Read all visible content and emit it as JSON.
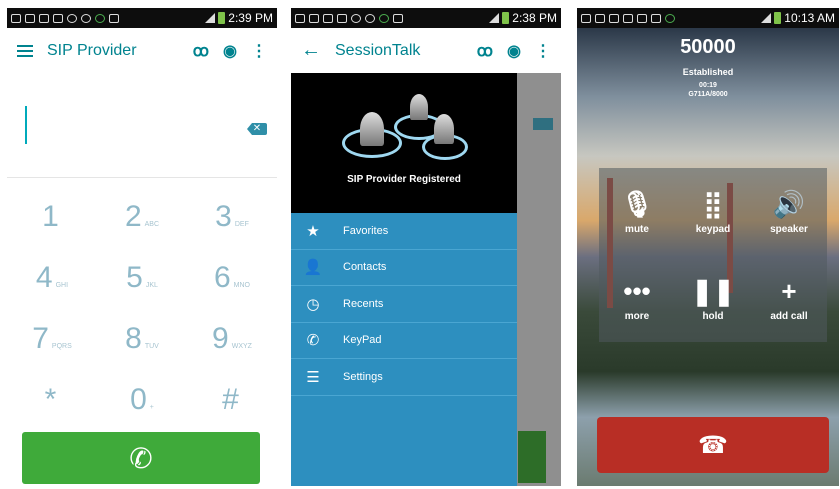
{
  "phone1": {
    "time": "2:39 PM",
    "title": "SIP Provider",
    "keys": [
      [
        {
          "d": "1",
          "l": ""
        },
        {
          "d": "2",
          "l": "ABC"
        },
        {
          "d": "3",
          "l": "DEF"
        }
      ],
      [
        {
          "d": "4",
          "l": "GHI"
        },
        {
          "d": "5",
          "l": "JKL"
        },
        {
          "d": "6",
          "l": "MNO"
        }
      ],
      [
        {
          "d": "7",
          "l": "PQRS"
        },
        {
          "d": "8",
          "l": "TUV"
        },
        {
          "d": "9",
          "l": "WXYZ"
        }
      ],
      [
        {
          "d": "*",
          "l": ""
        },
        {
          "d": "0",
          "l": "+"
        },
        {
          "d": "#",
          "l": ""
        }
      ]
    ]
  },
  "phone2": {
    "time": "2:38 PM",
    "title": "SessionTalk",
    "registered": "SIP Provider Registered",
    "menu": [
      {
        "label": "Favorites",
        "icon": "star-icon"
      },
      {
        "label": "Contacts",
        "icon": "contacts-icon"
      },
      {
        "label": "Recents",
        "icon": "clock-icon"
      },
      {
        "label": "KeyPad",
        "icon": "phone-icon"
      },
      {
        "label": "Settings",
        "icon": "settings-icon"
      }
    ]
  },
  "phone3": {
    "time": "10:13 AM",
    "number": "50000",
    "status": "Established",
    "duration": "00:19",
    "codec": "G711A/8000",
    "controls": [
      "mute",
      "keypad",
      "speaker",
      "more",
      "hold",
      "add call"
    ]
  }
}
